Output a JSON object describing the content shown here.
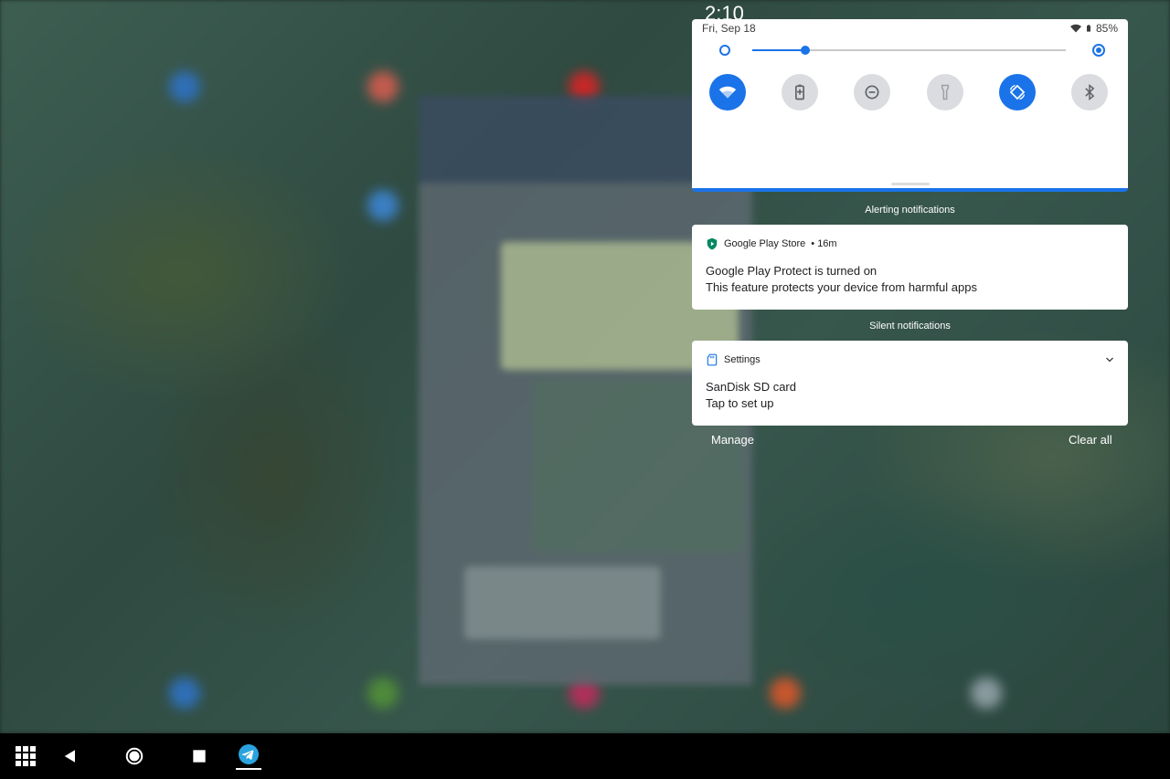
{
  "status_bar": {
    "time": "2:10",
    "date": "Fri, Sep 18",
    "battery": "85%"
  },
  "quick_settings": {
    "brightness_level": 0.17,
    "tiles": [
      {
        "name": "wifi",
        "icon": "wifi-icon",
        "on": true
      },
      {
        "name": "battery-saver",
        "icon": "battery-saver-icon",
        "on": false
      },
      {
        "name": "do-not-disturb",
        "icon": "do-not-disturb-icon",
        "on": false
      },
      {
        "name": "flashlight",
        "icon": "flashlight-icon",
        "on": false
      },
      {
        "name": "auto-rotate",
        "icon": "auto-rotate-icon",
        "on": true
      },
      {
        "name": "bluetooth",
        "icon": "bluetooth-icon",
        "on": false
      }
    ]
  },
  "sections": {
    "alerting": "Alerting notifications",
    "silent": "Silent notifications"
  },
  "notifications": [
    {
      "app": "Google Play Store",
      "time": "• 16m",
      "title": "Google Play Protect is turned on",
      "body": "This feature protects your device from harmful apps",
      "icon": "play-protect-icon"
    },
    {
      "app": "Settings",
      "title": "SanDisk SD card",
      "body": "Tap to set up",
      "icon": "sd-card-icon"
    }
  ],
  "actions": {
    "manage": "Manage",
    "clear_all": "Clear all"
  },
  "navbar": {
    "items": [
      "app-drawer-icon",
      "back-icon",
      "home-icon",
      "recents-icon",
      "telegram-icon"
    ]
  },
  "colors": {
    "accent": "#1a73e8",
    "tile_off": "#dadce0",
    "navbar": "#000000"
  }
}
